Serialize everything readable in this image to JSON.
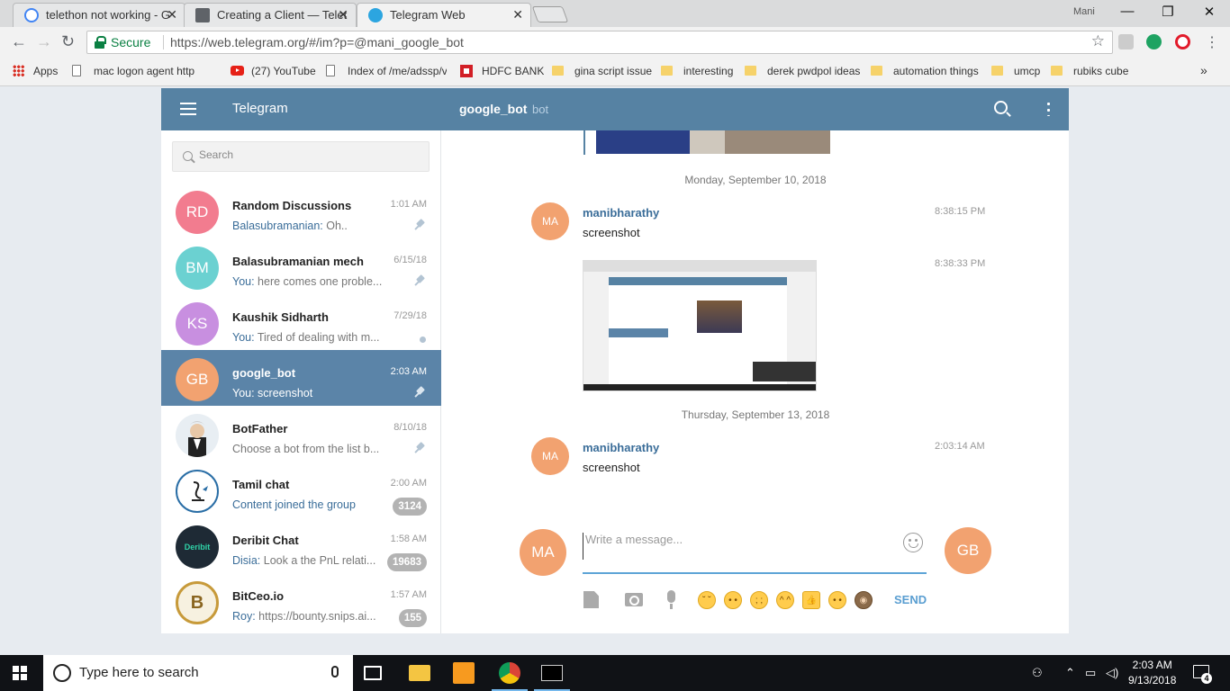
{
  "browser": {
    "tabs": [
      {
        "title": "telethon not working - G",
        "icon": "google-icon"
      },
      {
        "title": "Creating a Client — Telet",
        "icon": "docs-icon"
      },
      {
        "title": "Telegram Web",
        "icon": "telegram-icon"
      }
    ],
    "profile_name": "Mani",
    "secure_label": "Secure",
    "url": "https://web.telegram.org/#/im?p=@mani_google_bot",
    "bookmarks": [
      {
        "label": "Apps",
        "icon": "apps-grid-icon"
      },
      {
        "label": "mac logon agent http",
        "icon": "page-icon"
      },
      {
        "label": "(27) YouTube",
        "icon": "youtube-icon"
      },
      {
        "label": "Index of /me/adssp/v",
        "icon": "page-icon"
      },
      {
        "label": "HDFC BANK",
        "icon": "hdfc-icon"
      },
      {
        "label": "gina script issue",
        "icon": "folder-icon"
      },
      {
        "label": "interesting",
        "icon": "folder-icon"
      },
      {
        "label": "derek pwdpol ideas",
        "icon": "folder-icon"
      },
      {
        "label": "automation things",
        "icon": "folder-icon"
      },
      {
        "label": "umcp",
        "icon": "folder-icon"
      },
      {
        "label": "rubiks cube",
        "icon": "folder-icon"
      }
    ],
    "more_bookmarks": "»"
  },
  "telegram": {
    "app_title": "Telegram",
    "peer_name": "google_bot",
    "peer_status": "bot",
    "search_placeholder": "Search",
    "dialogs": [
      {
        "initials": "RD",
        "color": "#f27c8f",
        "name": "Random Discussions",
        "time": "1:01 AM",
        "sender": "Balasubramanian:",
        "message": " Oh..",
        "indicator": "pin"
      },
      {
        "initials": "BM",
        "color": "#6bd1d1",
        "name": "Balasubramanian mech",
        "time": "6/15/18",
        "sender": "You:",
        "message": " here comes one proble...",
        "indicator": "pin"
      },
      {
        "initials": "KS",
        "color": "#c88fe0",
        "name": "Kaushik Sidharth",
        "time": "7/29/18",
        "sender": "You:",
        "message": " Tired of dealing with m...",
        "indicator": "dot"
      },
      {
        "initials": "GB",
        "color": "#f2a270",
        "name": "google_bot",
        "time": "2:03 AM",
        "sender": "You:",
        "message": " screenshot",
        "indicator": "pin",
        "active": true
      },
      {
        "initials": "",
        "color": "#e8eef3",
        "name": "BotFather",
        "time": "8/10/18",
        "sender": "",
        "message": "Choose a bot from the list b...",
        "indicator": "pin"
      },
      {
        "initials": "",
        "color": "#ffffff",
        "name": "Tamil chat",
        "time": "2:00 AM",
        "sender": "",
        "message": "Content joined the group",
        "indicator": "badge",
        "badge": "3124"
      },
      {
        "initials": "Deribit",
        "color": "#1e2a35",
        "name": "Deribit Chat",
        "time": "1:58 AM",
        "sender": "Disia:",
        "message": " Look a the PnL relati...",
        "indicator": "badge",
        "badge": "19683"
      },
      {
        "initials": "B",
        "color": "#f7f1e0",
        "name": "BitCeo.io",
        "time": "1:57 AM",
        "sender": "Roy:",
        "message": " https://bounty.snips.ai...",
        "indicator": "badge",
        "badge": "155"
      }
    ],
    "messages": {
      "date1": "Monday, September 10, 2018",
      "msg1_author": "manibharathy",
      "msg1_avatar": "MA",
      "msg1_text": "screenshot",
      "msg1_time": "8:38:15 PM",
      "msg2_time": "8:38:33 PM",
      "date2": "Thursday, September 13, 2018",
      "msg3_author": "manibharathy",
      "msg3_avatar": "MA",
      "msg3_text": "screenshot",
      "msg3_time": "2:03:14 AM"
    },
    "composer": {
      "left_avatar": "MA",
      "right_avatar": "GB",
      "placeholder": "Write a message...",
      "send_label": "SEND",
      "quick_emojis": [
        "unamused",
        "neutral",
        "crying",
        "joy",
        "thumbs-up",
        "confused",
        "see-no-evil"
      ]
    }
  },
  "taskbar": {
    "search_placeholder": "Type here to search",
    "clock_time": "2:03 AM",
    "clock_date": "9/13/2018",
    "notification_count": "4"
  }
}
